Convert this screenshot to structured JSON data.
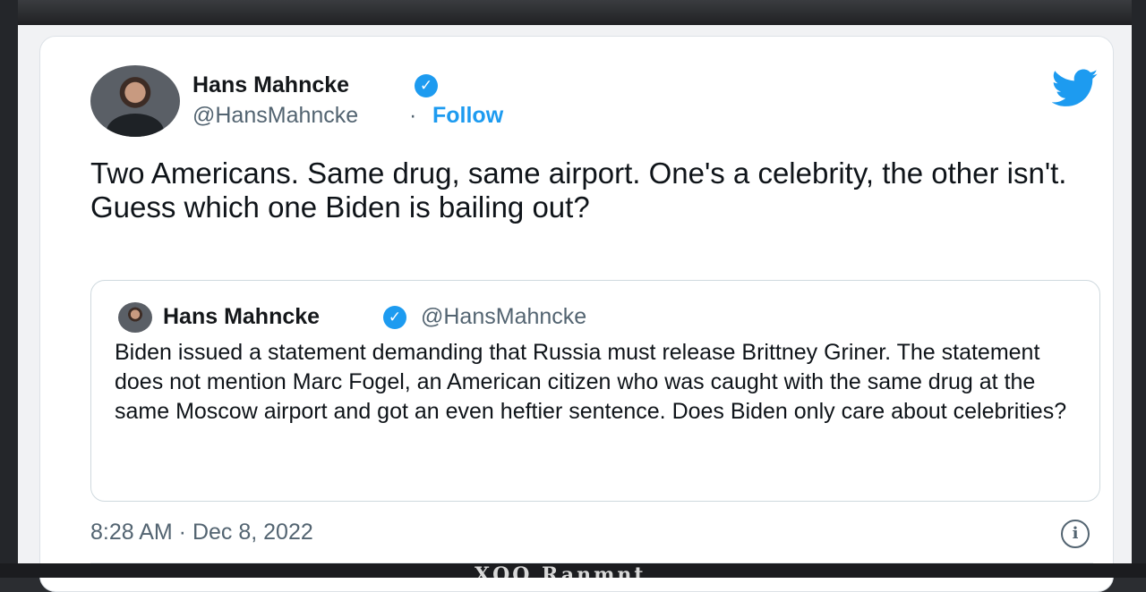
{
  "tweet": {
    "author": {
      "name": "Hans Mahncke",
      "handle": "@HansMahncke",
      "verified_mark": "✓",
      "follow_label": "Follow",
      "separator": "·"
    },
    "text": "Two Americans. Same drug, same airport. One's a celebrity, the other isn't. Guess which one Biden is bailing out?",
    "timestamp": "8:28 AM · Dec 8, 2022",
    "info_glyph": "i",
    "quoted": {
      "name": "Hans Mahncke",
      "handle": "@HansMahncke",
      "verified_mark": "✓",
      "text": "Biden issued a statement demanding that Russia must release Brittney Griner. The statement does not mention Marc Fogel, an American citizen who was caught with the same drug at the same Moscow airport and got an even heftier sentence. Does Biden only care about celebrities?"
    }
  },
  "bottom_caption": "XQQ Ranmnt",
  "colors": {
    "accent": "#1d9bf0",
    "text": "#0f1419",
    "secondary_text": "#536471",
    "card_border": "#cfd9de"
  },
  "icons": [
    "twitter-bird-icon",
    "verified-badge-icon",
    "info-icon"
  ]
}
